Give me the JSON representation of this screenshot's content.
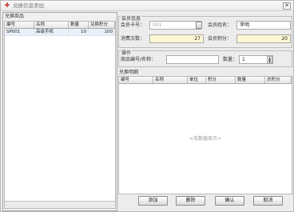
{
  "window": {
    "title": "兑换信息添加",
    "close_glyph": "✕",
    "icon": "plus-icon"
  },
  "left_panel": {
    "caption": "兑换商品",
    "columns": [
      "编号",
      "名称",
      "数量",
      "兑换积分"
    ],
    "rows": [
      {
        "code": "SP001",
        "name": "高级手机",
        "qty": "10",
        "points": "100"
      }
    ]
  },
  "member": {
    "group_title": "会员信息",
    "card_label": "会员卡号：",
    "card_placeholder": "001",
    "name_label": "会员姓名：",
    "name_value": "李明",
    "spend_label": "消费次数：",
    "spend_value": "27",
    "points_label": "会员积分：",
    "points_value": "20"
  },
  "operation": {
    "group_title": "操作",
    "product_label": "商品编号/名称：",
    "product_value": "",
    "qty_label": "数量：",
    "qty_value": "1"
  },
  "details": {
    "group_title": "兑换明细",
    "columns": [
      "编号",
      "名称",
      "单位",
      "积分",
      "数量",
      "总积分"
    ],
    "empty_text": "<无数据显示>"
  },
  "buttons": {
    "add": "添加",
    "delete": "删除",
    "confirm": "确认",
    "cancel": "取消"
  }
}
